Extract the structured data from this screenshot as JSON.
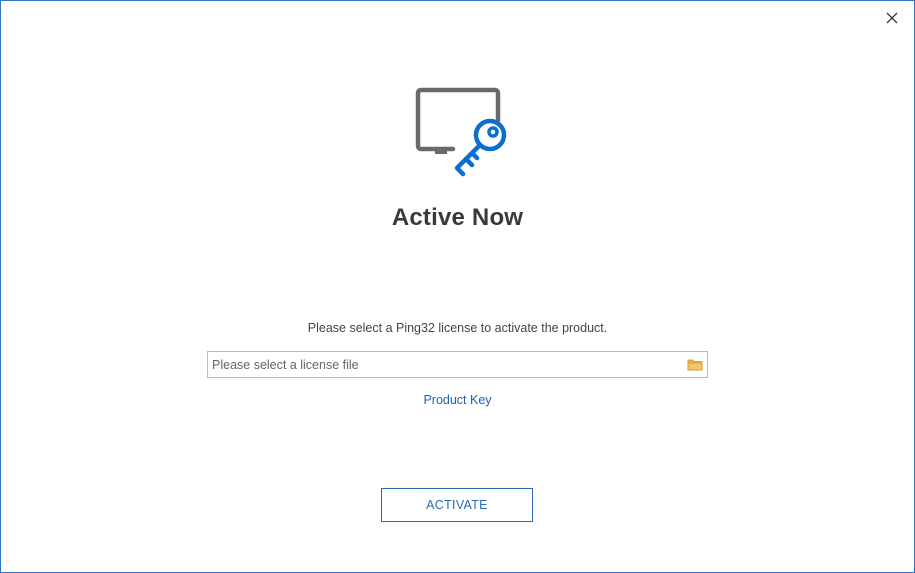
{
  "dialog": {
    "close_icon": "close-icon",
    "hero_icon": "monitor-key-icon",
    "title": "Active Now",
    "instruction": "Please select a Ping32 license to activate the product.",
    "license_input": {
      "value": "",
      "placeholder": "Please select a license file",
      "browse_icon": "folder-icon"
    },
    "product_key_link": "Product Key",
    "activate_button": "ACTIVATE"
  },
  "colors": {
    "window_border": "#2b74c7",
    "accent_blue": "#0b6fd1",
    "monitor_gray": "#6a6a6a",
    "link_blue": "#1f63b0",
    "folder_yellow": "#e6b84f"
  }
}
